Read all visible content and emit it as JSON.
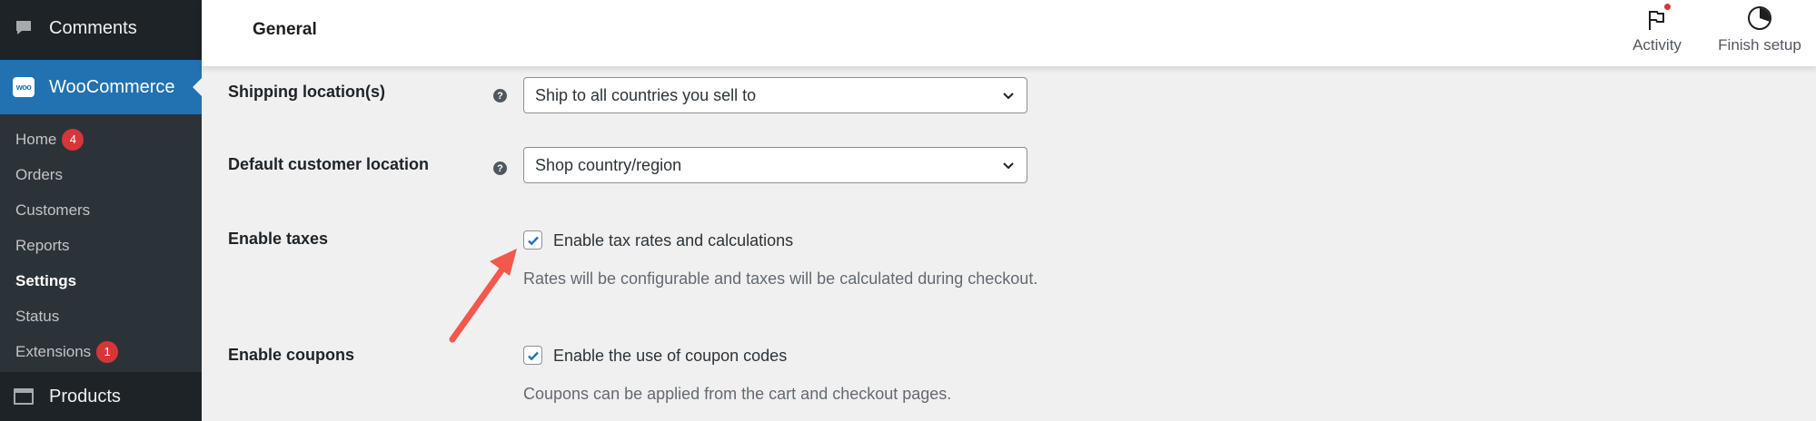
{
  "sidebar": {
    "comments_label": "Comments",
    "woo_label": "WooCommerce",
    "woo_logo_text": "woo",
    "submenu": [
      {
        "label": "Home",
        "badge": "4"
      },
      {
        "label": "Orders"
      },
      {
        "label": "Customers"
      },
      {
        "label": "Reports"
      },
      {
        "label": "Settings",
        "current": true
      },
      {
        "label": "Status"
      },
      {
        "label": "Extensions",
        "badge": "1"
      }
    ],
    "products_label": "Products"
  },
  "header": {
    "title": "General",
    "activity_label": "Activity",
    "finish_setup_label": "Finish setup"
  },
  "settings": {
    "shipping_locations": {
      "label": "Shipping location(s)",
      "value": "Ship to all countries you sell to"
    },
    "default_customer_location": {
      "label": "Default customer location",
      "value": "Shop country/region"
    },
    "enable_taxes": {
      "label": "Enable taxes",
      "checkbox_label": "Enable tax rates and calculations",
      "checked": true,
      "description": "Rates will be configurable and taxes will be calculated during checkout."
    },
    "enable_coupons": {
      "label": "Enable coupons",
      "checkbox_label": "Enable the use of coupon codes",
      "checked": true,
      "description": "Coupons can be applied from the cart and checkout pages."
    },
    "help_glyph": "?"
  },
  "colors": {
    "sidebar_bg": "#1d2327",
    "submenu_bg": "#2c3338",
    "accent": "#2271b1",
    "badge": "#d63638",
    "annotation_arrow": "#f4574b"
  },
  "icons": {
    "comments": "speech-bubble-icon",
    "woo": "woo-logo-icon",
    "products": "archive-box-icon",
    "activity": "flag-icon",
    "finish_setup": "progress-circle-icon",
    "help": "help-icon",
    "select": "chevron-down-icon",
    "checkbox": "checkmark-icon"
  }
}
